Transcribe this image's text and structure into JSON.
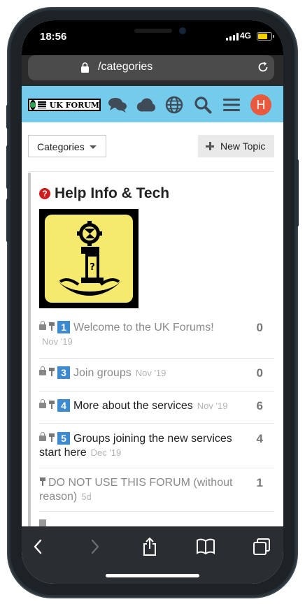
{
  "status": {
    "time": "18:56",
    "network": "4G",
    "battery_level": 0.75
  },
  "browser": {
    "url": "/categories"
  },
  "header": {
    "logo_text": "UK FORUM",
    "avatar_letter": "H"
  },
  "controls": {
    "categories_label": "Categories",
    "new_topic_label": "New Topic"
  },
  "category": {
    "title": "Help Info & Tech",
    "icon": "question-circle-icon"
  },
  "topics": [
    {
      "number": "1",
      "title": "Welcome to the UK Forums!",
      "date": "Nov '19",
      "count": "0",
      "locked": true,
      "pinned": true,
      "read": true
    },
    {
      "number": "3",
      "title": "Join groups",
      "date": "Nov '19",
      "count": "0",
      "locked": true,
      "pinned": true,
      "read": true
    },
    {
      "number": "4",
      "title": "More about the services",
      "date": "Nov '19",
      "count": "6",
      "locked": true,
      "pinned": true,
      "read": false
    },
    {
      "number": "5",
      "title": "Groups joining the new services start here",
      "date": "Dec '19",
      "count": "4",
      "locked": true,
      "pinned": true,
      "read": false
    },
    {
      "number": "",
      "title": "DO NOT USE THIS FORUM (without reason)",
      "date": "5d",
      "count": "1",
      "locked": false,
      "pinned": true,
      "read": true
    }
  ],
  "colors": {
    "header_bg": "#74cbec",
    "avatar": "#e8593e",
    "badge": "#3d8ad1",
    "help_icon": "#d11a1a"
  }
}
